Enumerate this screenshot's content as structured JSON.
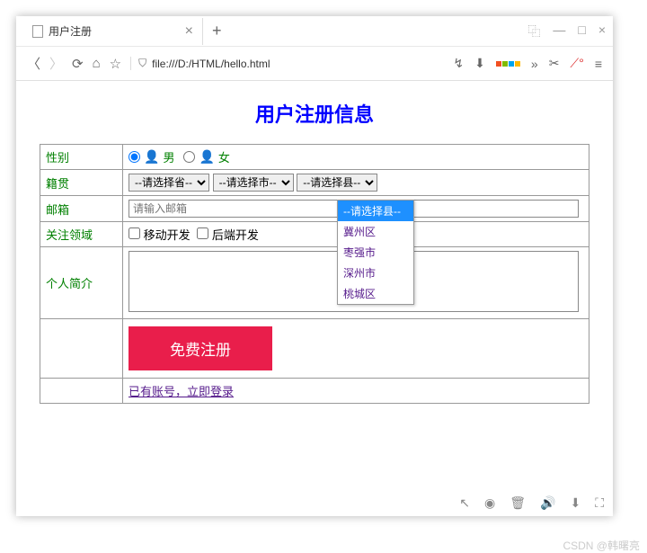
{
  "window": {
    "tab_title": "用户注册",
    "url": "file:///D:/HTML/hello.html",
    "win_minimize": "—",
    "win_maximize": "□",
    "win_close": "×"
  },
  "page": {
    "title": "用户注册信息",
    "gender_label": "性别",
    "gender_male": "男",
    "gender_female": "女",
    "origin_label": "籍贯",
    "province_placeholder": "--请选择省--",
    "city_placeholder": "--请选择市--",
    "county_placeholder": "--请选择县--",
    "email_label": "邮箱",
    "email_placeholder": "请输入邮箱",
    "interest_label": "关注领域",
    "interest_options": [
      "移动开发",
      "后端开发"
    ],
    "bio_label": "个人简介",
    "submit_label": "免费注册",
    "login_link": "已有账号，立即登录"
  },
  "dropdown": {
    "options": [
      "--请选择县--",
      "冀州区",
      "枣强市",
      "深州市",
      "桃城区"
    ],
    "selected_index": 0
  },
  "watermark": "CSDN @韩曙亮"
}
